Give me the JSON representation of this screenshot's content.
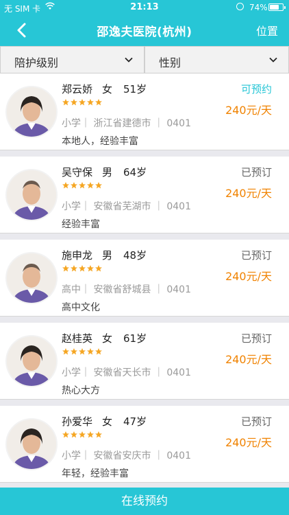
{
  "status_bar": {
    "carrier": "无 SIM 卡",
    "time": "21:13",
    "battery": "74%",
    "battery_level": 0.74
  },
  "nav": {
    "title": "邵逸夫医院(杭州)",
    "right_label": "位置"
  },
  "filters": [
    {
      "label": "陪护级别"
    },
    {
      "label": "性别"
    }
  ],
  "caregivers": [
    {
      "name": "郑云娇",
      "gender": "女",
      "age": "51岁",
      "rating": 5,
      "education": "小学",
      "hometown": "浙江省建德市",
      "code": "0401",
      "description": "本地人，经验丰富",
      "status": "可预约",
      "available": true,
      "price": "240元/天"
    },
    {
      "name": "吴守保",
      "gender": "男",
      "age": "64岁",
      "rating": 5,
      "education": "小学",
      "hometown": "安徽省芜湖市",
      "code": "0401",
      "description": "经验丰富",
      "status": "已预订",
      "available": false,
      "price": "240元/天"
    },
    {
      "name": "施申龙",
      "gender": "男",
      "age": "48岁",
      "rating": 5,
      "education": "高中",
      "hometown": "安徽省舒城县",
      "code": "0401",
      "description": "高中文化",
      "status": "已预订",
      "available": false,
      "price": "240元/天"
    },
    {
      "name": "赵桂英",
      "gender": "女",
      "age": "61岁",
      "rating": 5,
      "education": "小学",
      "hometown": "安徽省天长市",
      "code": "0401",
      "description": "热心大方",
      "status": "已预订",
      "available": false,
      "price": "240元/天"
    },
    {
      "name": "孙爱华",
      "gender": "女",
      "age": "47岁",
      "rating": 5,
      "education": "小学",
      "hometown": "安徽省安庆市",
      "code": "0401",
      "description": "年轻，经验丰富",
      "status": "已预订",
      "available": false,
      "price": "240元/天"
    }
  ],
  "bottom_button": "在线预约",
  "colors": {
    "accent": "#27c6d6",
    "price": "#f08200",
    "star": "#f5a623"
  },
  "icons": {
    "back": "chevron-left-icon",
    "dropdown": "chevron-down-icon",
    "wifi": "wifi-icon",
    "lock": "orientation-lock-icon",
    "battery": "battery-icon",
    "star": "star-icon"
  }
}
